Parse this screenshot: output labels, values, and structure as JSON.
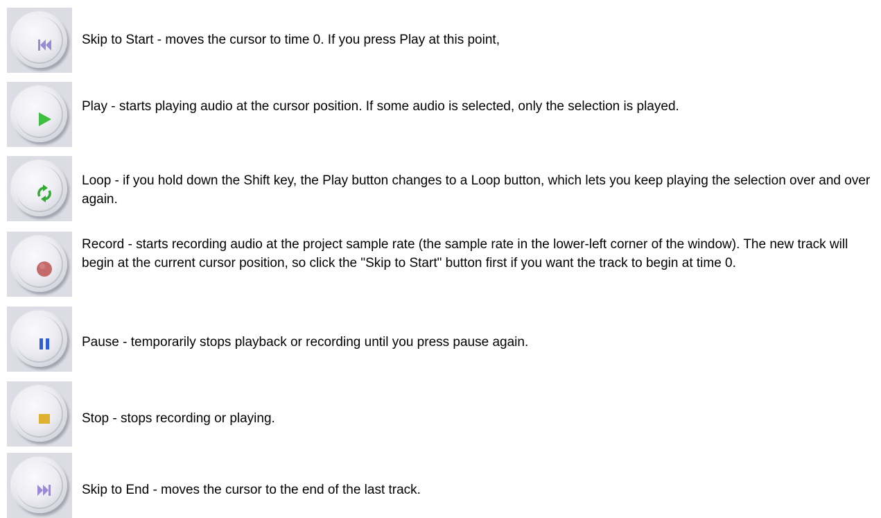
{
  "buttons": [
    {
      "name": "skip-to-start",
      "icon": "skip-to-start-icon",
      "color": "#9a8ad6",
      "text": "Skip to Start - moves the cursor to time 0. If you press Play at this point,"
    },
    {
      "name": "play",
      "icon": "play-icon",
      "color": "#3fbf3f",
      "text": "Play - starts playing audio at the cursor position. If some audio is selected, only the selection is played."
    },
    {
      "name": "loop",
      "icon": "loop-icon",
      "color": "#33aa33",
      "text": "Loop - if you hold down the Shift key, the Play button changes to a Loop button, which lets you keep playing the selection over and over again."
    },
    {
      "name": "record",
      "icon": "record-icon",
      "color": "#c46a6a",
      "text": "Record - starts recording audio at the project sample rate (the sample rate in the lower-left corner of the window). The new track will begin at the current cursor position, so click the \"Skip to Start\" button first if you want the track to begin at time 0."
    },
    {
      "name": "pause",
      "icon": "pause-icon",
      "color": "#2f5fd6",
      "text": "Pause - temporarily stops playback or recording until you press pause again."
    },
    {
      "name": "stop",
      "icon": "stop-icon",
      "color": "#e0b030",
      "text": "Stop - stops recording or playing."
    },
    {
      "name": "skip-to-end",
      "icon": "skip-to-end-icon",
      "color": "#9a8ad6",
      "text": "Skip to End - moves the cursor to the end of the last track."
    }
  ]
}
